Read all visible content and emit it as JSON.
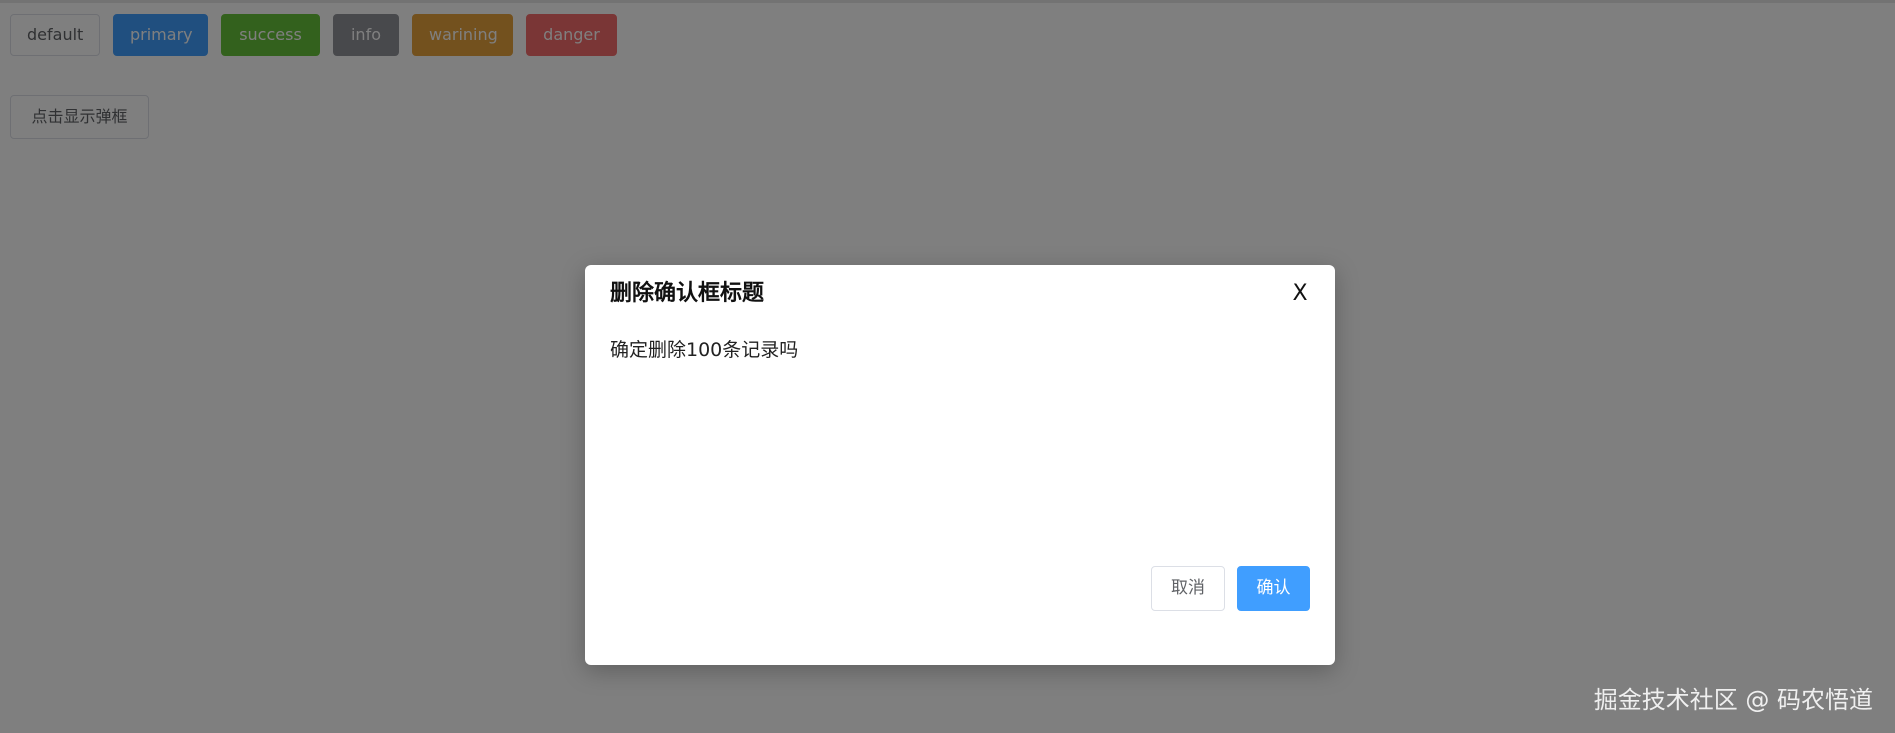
{
  "top_buttons": [
    {
      "label": "default"
    },
    {
      "label": "primary"
    },
    {
      "label": "success"
    },
    {
      "label": "info"
    },
    {
      "label": "warining"
    },
    {
      "label": "danger"
    }
  ],
  "show_dialog_button": "点击显示弹框",
  "dialog": {
    "title": "删除确认框标题",
    "close_label": "X",
    "message": "确定删除100条记录吗",
    "cancel_label": "取消",
    "confirm_label": "确认"
  },
  "watermark": "掘金技术社区 @ 码农悟道",
  "colors": {
    "primary": "#409eff",
    "success": "#67c23a",
    "info": "#909399",
    "warning": "#e6a23c",
    "danger": "#f56c6c",
    "overlay": "rgba(0,0,0,0.5)"
  }
}
